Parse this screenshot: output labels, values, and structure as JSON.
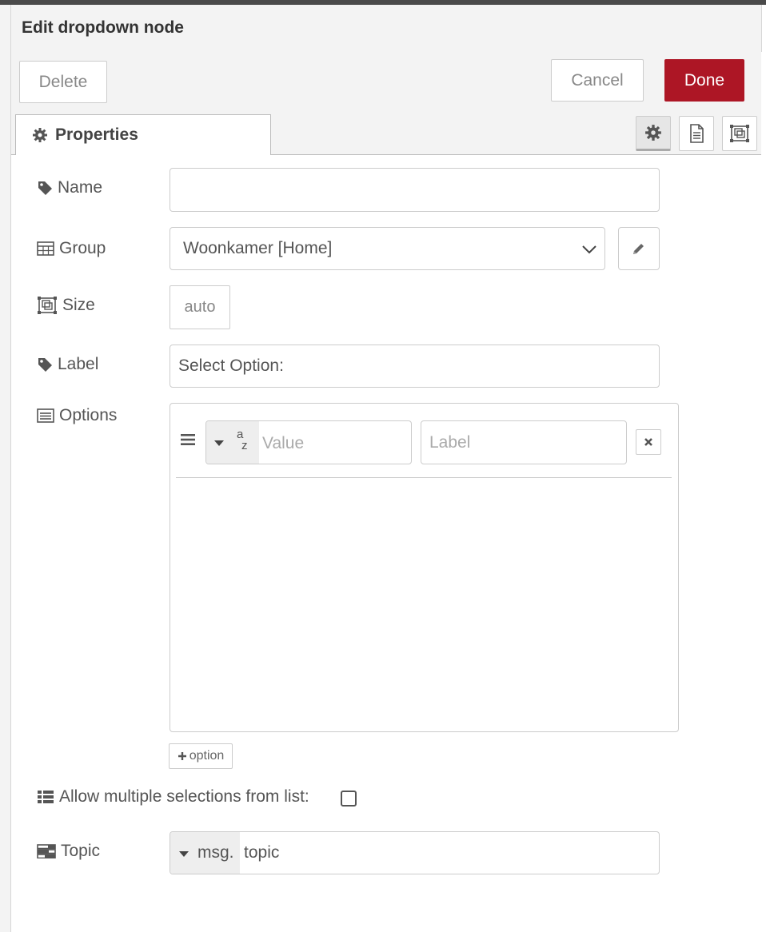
{
  "tray": {
    "title": "Edit dropdown node"
  },
  "toolbar": {
    "delete_label": "Delete",
    "cancel_label": "Cancel",
    "done_label": "Done"
  },
  "tabs": {
    "properties_label": "Properties"
  },
  "form": {
    "name": {
      "label": "Name",
      "value": "",
      "placeholder": ""
    },
    "group": {
      "label": "Group",
      "selected": "Woonkamer [Home]"
    },
    "size": {
      "label": "Size",
      "value": "auto"
    },
    "label_field": {
      "label": "Label",
      "value": "Select Option:"
    },
    "options": {
      "label": "Options",
      "value_placeholder": "Value",
      "label_placeholder": "Label",
      "type_glyph_top": "a",
      "type_glyph_bottom": "z",
      "add_label": "option"
    },
    "multiple": {
      "label": "Allow multiple selections from list:",
      "checked": false
    },
    "topic": {
      "label": "Topic",
      "prefix": "msg.",
      "value": "topic"
    }
  },
  "colors": {
    "done_button": "#ad1625",
    "header_bg": "#f3f3f3",
    "border": "#cccccc"
  }
}
